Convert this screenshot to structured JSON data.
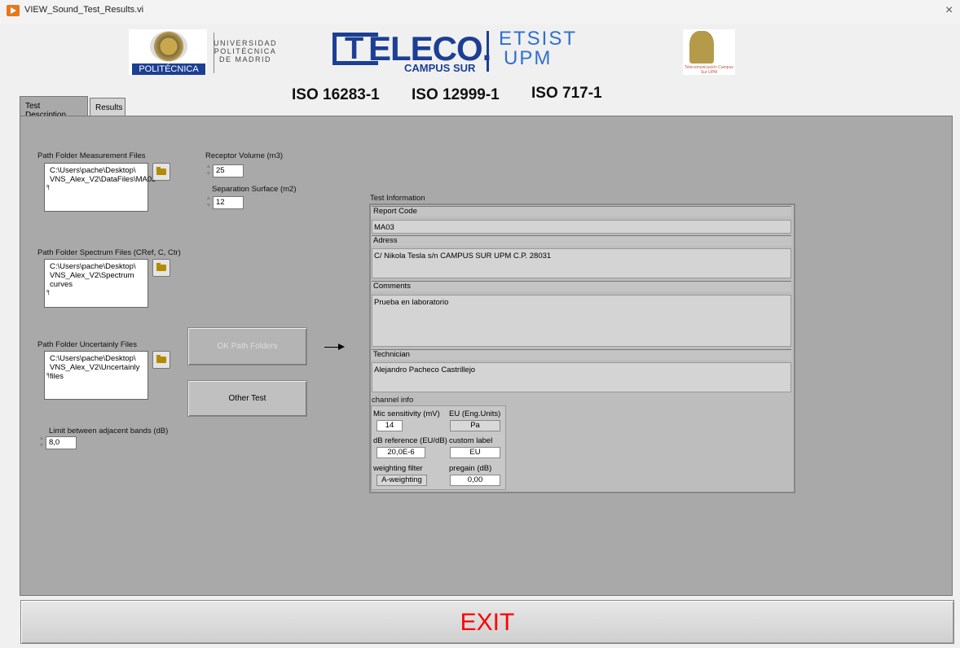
{
  "window": {
    "title": "VIEW_Sound_Test_Results.vi",
    "close": "×"
  },
  "logos": {
    "upm_band": "POLITÉCNICA",
    "upm_text": "UNIVERSIDAD POLITÉCNICA DE MADRID",
    "teleco_word": "ELECO.",
    "teleco_t": "T",
    "teleco_campus": "CAMPUS SUR",
    "etsist_line1": "ETSIST",
    "etsist_line2": "UPM",
    "seal_text": "Telecomunicación Campus Sur UPM"
  },
  "standards": [
    "ISO 16283-1",
    "ISO 12999-1",
    "ISO 717-1"
  ],
  "tabs": [
    {
      "label": "Test Description",
      "active": true
    },
    {
      "label": "Results",
      "active": false
    }
  ],
  "paths": {
    "measurement": {
      "label": "Path Folder Measurement Files",
      "value": "C:\\Users\\pache\\Desktop\\ VNS_Alex_V2\\DataFiles\\MA03"
    },
    "spectrum": {
      "label": "Path Folder  Spectrum Files (CRef, C, Ctr)",
      "value": "C:\\Users\\pache\\Desktop\\ VNS_Alex_V2\\Spectrum curves"
    },
    "uncertainty": {
      "label": "Path Folder  Uncertainly Files",
      "value": "C:\\Users\\pache\\Desktop\\ VNS_Alex_V2\\Uncertainly files"
    }
  },
  "numerics": {
    "receptor_volume": {
      "label": "Receptor Volume (m3)",
      "value": "25"
    },
    "separation_surface": {
      "label": "Separation Surface (m2)",
      "value": "12"
    },
    "limit_bands": {
      "label": "Limit between adjacent bands (dB)",
      "value": "8,0"
    }
  },
  "buttons": {
    "ok_path": "OK Path Folders",
    "other_test": "Other Test",
    "exit": "EXIT"
  },
  "test_info": {
    "title": "Test Information",
    "report_code": {
      "label": "Report Code",
      "value": "MA03"
    },
    "address": {
      "label": "Adress",
      "value": "C/ Nikola Tesla s/n CAMPUS SUR UPM C.P. 28031"
    },
    "comments": {
      "label": "Comments",
      "value": "Prueba en laboratorio"
    },
    "technician": {
      "label": "Technician",
      "value": "Alejandro Pacheco Castrillejo"
    },
    "channel": {
      "title": "channel info",
      "mic_sensitivity": {
        "label": "Mic sensitivity (mV)",
        "value": "14"
      },
      "eu": {
        "label": "EU (Eng.Units)",
        "value": "Pa"
      },
      "db_reference": {
        "label": "dB reference (EU/dB)",
        "value": "20,0E-6"
      },
      "custom_label": {
        "label": "custom label",
        "value": "EU"
      },
      "weighting": {
        "label": "weighting filter",
        "value": "A-weighting"
      },
      "pregain": {
        "label": "pregain (dB)",
        "value": "0,00"
      }
    }
  },
  "colors": {
    "panel": "#a9a9a9",
    "exit_text": "#ff0000",
    "brand_blue": "#1c3f94"
  },
  "icons": {
    "app": "labview-vi-icon",
    "browse": "folder-icon",
    "close": "close-icon"
  }
}
